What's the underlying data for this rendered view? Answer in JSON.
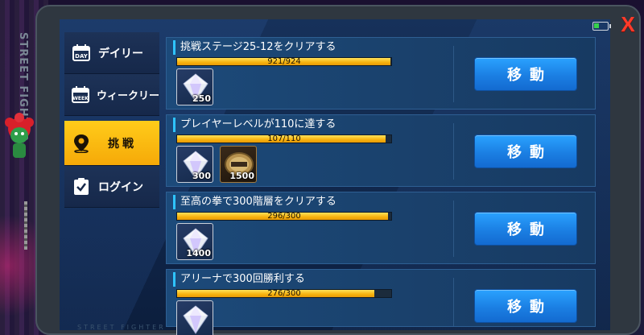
{
  "brand_vertical": "STREET FIGHTER",
  "footer_brand": "STREET FIGHTER",
  "close_label": "X",
  "sidebar": {
    "items": [
      {
        "label": "デイリー",
        "icon": "calendar-day-icon",
        "active": false
      },
      {
        "label": "ウィークリー",
        "icon": "calendar-week-icon",
        "active": false
      },
      {
        "label": "挑戦",
        "icon": "location-pin-icon",
        "active": true
      },
      {
        "label": "ログイン",
        "icon": "checkbox-icon",
        "active": false
      }
    ]
  },
  "missions": [
    {
      "title": "挑戦ステージ25-12をクリアする",
      "progress_text": "921/924",
      "progress": 0.9968,
      "rewards": [
        {
          "type": "diamond",
          "qty": "250"
        }
      ],
      "button": "移動"
    },
    {
      "title": "プレイヤーレベルが110に達する",
      "progress_text": "107/110",
      "progress": 0.9727,
      "rewards": [
        {
          "type": "diamond",
          "qty": "300"
        },
        {
          "type": "battle-ticket",
          "qty": "1500"
        }
      ],
      "button": "移動"
    },
    {
      "title": "至高の拳で300階層をクリアする",
      "progress_text": "296/300",
      "progress": 0.9867,
      "rewards": [
        {
          "type": "diamond",
          "qty": "1400"
        }
      ],
      "button": "移動"
    },
    {
      "title": "アリーナで300回勝利する",
      "progress_text": "276/300",
      "progress": 0.92,
      "rewards": [
        {
          "type": "diamond",
          "qty": ""
        }
      ],
      "button": "移動"
    }
  ],
  "colors": {
    "active_tab": "#f6a908",
    "move_button": "#1b7fe3",
    "progress_fill": "#f7b20e",
    "close": "#ff3b2a",
    "battery": "#38d24c"
  }
}
